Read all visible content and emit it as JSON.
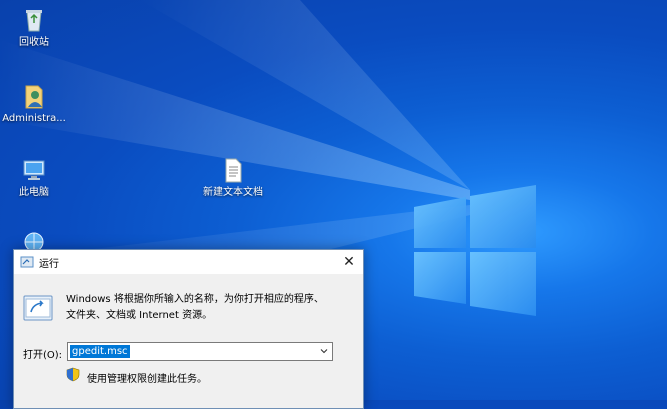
{
  "desktop": {
    "icons": [
      {
        "label": "回收站",
        "icon": "recycle-bin-icon"
      },
      {
        "label": "Administra...",
        "icon": "user-folder-icon"
      },
      {
        "label": "此电脑",
        "icon": "computer-icon"
      },
      {
        "label": "新建文本文档",
        "icon": "text-document-icon"
      },
      {
        "label": "",
        "icon": "network-icon"
      }
    ]
  },
  "run_dialog": {
    "title": "运行",
    "close_glyph": "✕",
    "description_line1": "Windows 将根据你所输入的名称，为你打开相应的程序、",
    "description_line2": "文件夹、文档或 Internet 资源。",
    "open_label": "打开(O):",
    "input_value": "gpedit.msc",
    "admin_note": "使用管理权限创建此任务。"
  },
  "colors": {
    "accent": "#0078d7",
    "desktop_blue": "#0a4cc0"
  }
}
